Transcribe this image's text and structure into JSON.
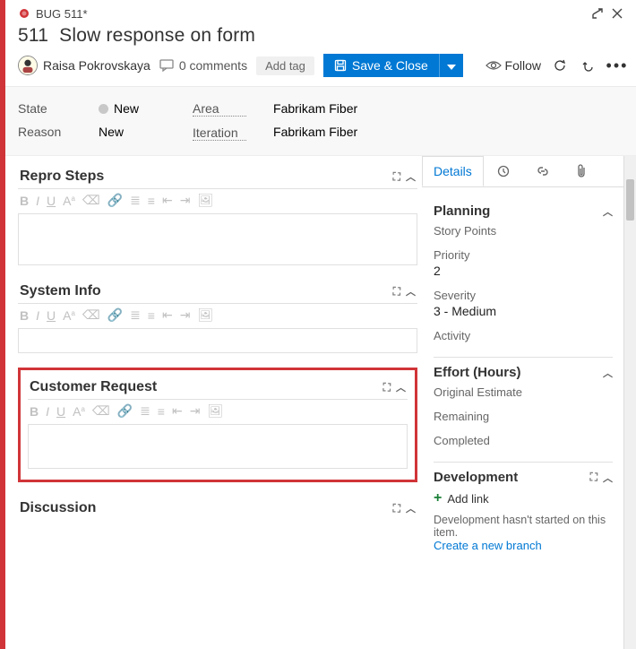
{
  "header": {
    "work_item_label": "BUG 511*",
    "id": "511",
    "title": "Slow response on form"
  },
  "actionbar": {
    "assignee": "Raisa Pokrovskaya",
    "comments": "0 comments",
    "add_tag": "Add tag",
    "save_close": "Save & Close",
    "follow": "Follow"
  },
  "meta": {
    "state_label": "State",
    "state_value": "New",
    "reason_label": "Reason",
    "reason_value": "New",
    "area_label": "Area",
    "area_value": "Fabrikam Fiber",
    "iteration_label": "Iteration",
    "iteration_value": "Fabrikam Fiber"
  },
  "left_panels": {
    "repro": "Repro Steps",
    "sysinfo": "System Info",
    "customer_request": "Customer Request",
    "discussion": "Discussion"
  },
  "tabs": {
    "details": "Details"
  },
  "planning": {
    "heading": "Planning",
    "story_points_label": "Story Points",
    "priority_label": "Priority",
    "priority_value": "2",
    "severity_label": "Severity",
    "severity_value": "3 - Medium",
    "activity_label": "Activity"
  },
  "effort": {
    "heading": "Effort (Hours)",
    "original": "Original Estimate",
    "remaining": "Remaining",
    "completed": "Completed"
  },
  "development": {
    "heading": "Development",
    "add_link": "Add link",
    "empty_msg": "Development hasn't started on this item.",
    "create_branch": "Create a new branch"
  }
}
